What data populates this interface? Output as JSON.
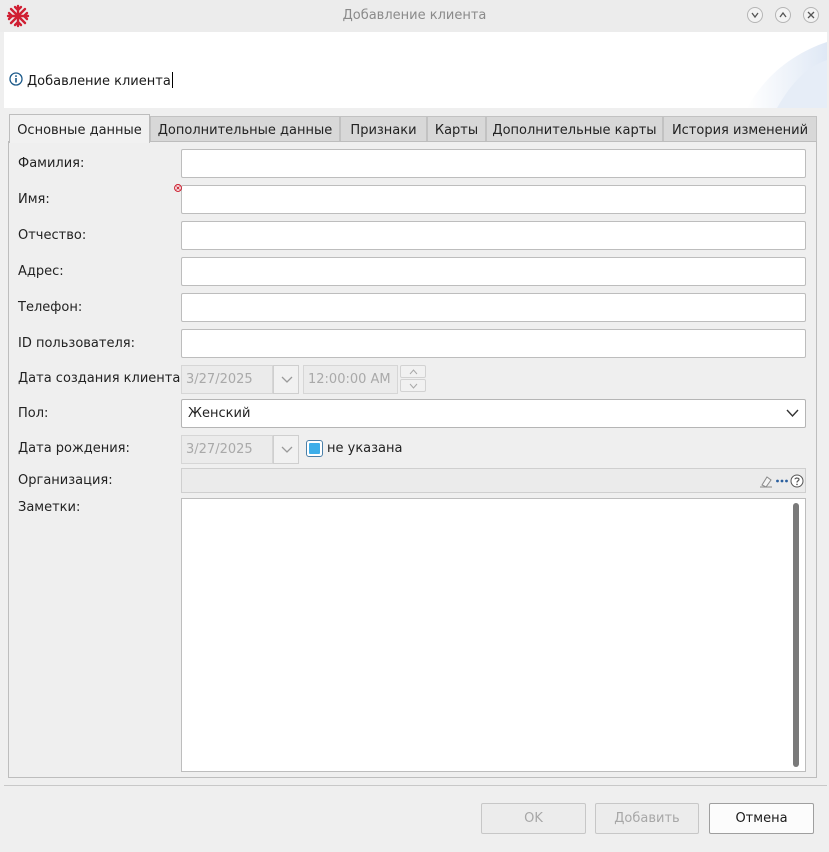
{
  "window": {
    "title": "Добавление клиента"
  },
  "banner": {
    "text": "Добавление клиента"
  },
  "tabs": [
    {
      "label": "Основные данные",
      "active": true
    },
    {
      "label": "Дополнительные данные"
    },
    {
      "label": "Признаки"
    },
    {
      "label": "Карты"
    },
    {
      "label": "Дополнительные карты"
    },
    {
      "label": "История изменений"
    }
  ],
  "form": {
    "last_name": {
      "label": "Фамилия:",
      "value": ""
    },
    "first_name": {
      "label": "Имя:",
      "value": "",
      "required": true
    },
    "middle_name": {
      "label": "Отчество:",
      "value": ""
    },
    "address": {
      "label": "Адрес:",
      "value": ""
    },
    "phone": {
      "label": "Телефон:",
      "value": ""
    },
    "user_id": {
      "label": "ID пользователя:",
      "value": ""
    },
    "created": {
      "label": "Дата создания клиента:",
      "date": "3/27/2025",
      "time": "12:00:00 AM"
    },
    "gender": {
      "label": "Пол:",
      "value": "Женский"
    },
    "birth_date": {
      "label": "Дата рождения:",
      "date": "3/27/2025",
      "not_specified_label": "не указана",
      "not_specified_checked": true
    },
    "organization": {
      "label": "Организация:",
      "value": ""
    },
    "notes": {
      "label": "Заметки:",
      "value": ""
    }
  },
  "buttons": {
    "ok": "OK",
    "add": "Добавить",
    "cancel": "Отмена"
  },
  "colors": {
    "logo": "#d01f33",
    "checkbox": "#3daee9",
    "required": "#cc2030"
  }
}
